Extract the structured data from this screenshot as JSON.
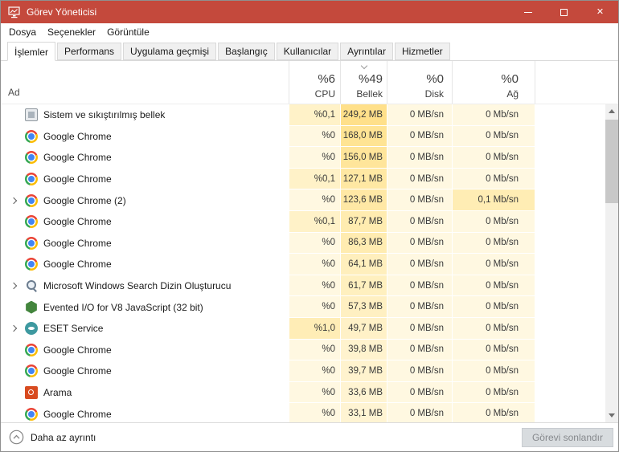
{
  "window": {
    "title": "Görev Yöneticisi"
  },
  "colors": {
    "titlebar": "#c4493c",
    "heat_base": "#fff8e1"
  },
  "menu": [
    "Dosya",
    "Seçenekler",
    "Görüntüle"
  ],
  "tabs": [
    "İşlemler",
    "Performans",
    "Uygulama geçmişi",
    "Başlangıç",
    "Kullanıcılar",
    "Ayrıntılar",
    "Hizmetler"
  ],
  "selected_tab": "İşlemler",
  "table": {
    "name_column_header": "Ad",
    "value_columns": [
      {
        "id": "cpu",
        "percent": "%6",
        "name": "CPU",
        "sorted": false
      },
      {
        "id": "mem",
        "percent": "%49",
        "name": "Bellek",
        "sorted": true
      },
      {
        "id": "disk",
        "percent": "%0",
        "name": "Disk",
        "sorted": false
      },
      {
        "id": "net",
        "percent": "%0",
        "name": "Ağ",
        "sorted": false
      }
    ],
    "rows": [
      {
        "name": "Sistem ve sıkıştırılmış bellek",
        "icon": "system",
        "expandable": false,
        "cpu": "%0,1",
        "mem": "249,2 MB",
        "disk": "0 MB/sn",
        "net": "0 Mb/sn",
        "heat": {
          "cpu": "#fff2c8",
          "mem": "#ffe08a",
          "disk": "#fff8e1",
          "net": "#fff8e1"
        }
      },
      {
        "name": "Google Chrome",
        "icon": "chrome",
        "expandable": false,
        "cpu": "%0",
        "mem": "168,0 MB",
        "disk": "0 MB/sn",
        "net": "0 Mb/sn",
        "heat": {
          "cpu": "#fff8e1",
          "mem": "#ffe494",
          "disk": "#fff8e1",
          "net": "#fff8e1"
        }
      },
      {
        "name": "Google Chrome",
        "icon": "chrome",
        "expandable": false,
        "cpu": "%0",
        "mem": "156,0 MB",
        "disk": "0 MB/sn",
        "net": "0 Mb/sn",
        "heat": {
          "cpu": "#fff8e1",
          "mem": "#ffe59a",
          "disk": "#fff8e1",
          "net": "#fff8e1"
        }
      },
      {
        "name": "Google Chrome",
        "icon": "chrome",
        "expandable": false,
        "cpu": "%0,1",
        "mem": "127,1 MB",
        "disk": "0 MB/sn",
        "net": "0 Mb/sn",
        "heat": {
          "cpu": "#fff2c8",
          "mem": "#ffe8a3",
          "disk": "#fff8e1",
          "net": "#fff8e1"
        }
      },
      {
        "name": "Google Chrome (2)",
        "icon": "chrome",
        "expandable": true,
        "cpu": "%0",
        "mem": "123,6 MB",
        "disk": "0 MB/sn",
        "net": "0,1 Mb/sn",
        "heat": {
          "cpu": "#fff8e1",
          "mem": "#ffe8a5",
          "disk": "#fff8e1",
          "net": "#ffedb4"
        }
      },
      {
        "name": "Google Chrome",
        "icon": "chrome",
        "expandable": false,
        "cpu": "%0,1",
        "mem": "87,7 MB",
        "disk": "0 MB/sn",
        "net": "0 Mb/sn",
        "heat": {
          "cpu": "#fff2c8",
          "mem": "#ffecb0",
          "disk": "#fff8e1",
          "net": "#fff8e1"
        }
      },
      {
        "name": "Google Chrome",
        "icon": "chrome",
        "expandable": false,
        "cpu": "%0",
        "mem": "86,3 MB",
        "disk": "0 MB/sn",
        "net": "0 Mb/sn",
        "heat": {
          "cpu": "#fff8e1",
          "mem": "#ffecb1",
          "disk": "#fff8e1",
          "net": "#fff8e1"
        }
      },
      {
        "name": "Google Chrome",
        "icon": "chrome",
        "expandable": false,
        "cpu": "%0",
        "mem": "64,1 MB",
        "disk": "0 MB/sn",
        "net": "0 Mb/sn",
        "heat": {
          "cpu": "#fff8e1",
          "mem": "#ffefbd",
          "disk": "#fff8e1",
          "net": "#fff8e1"
        }
      },
      {
        "name": "Microsoft Windows Search Dizin Oluşturucu",
        "icon": "search-indexer",
        "expandable": true,
        "cpu": "%0",
        "mem": "61,7 MB",
        "disk": "0 MB/sn",
        "net": "0 Mb/sn",
        "heat": {
          "cpu": "#fff8e1",
          "mem": "#fff0bf",
          "disk": "#fff8e1",
          "net": "#fff8e1"
        }
      },
      {
        "name": "Evented I/O for V8 JavaScript (32 bit)",
        "icon": "node",
        "expandable": false,
        "cpu": "%0",
        "mem": "57,3 MB",
        "disk": "0 MB/sn",
        "net": "0 Mb/sn",
        "heat": {
          "cpu": "#fff8e1",
          "mem": "#fff0c2",
          "disk": "#fff8e1",
          "net": "#fff8e1"
        }
      },
      {
        "name": "ESET Service",
        "icon": "eset",
        "expandable": true,
        "cpu": "%1,0",
        "mem": "49,7 MB",
        "disk": "0 MB/sn",
        "net": "0 Mb/sn",
        "heat": {
          "cpu": "#ffedb6",
          "mem": "#fff1c7",
          "disk": "#fff8e1",
          "net": "#fff8e1"
        }
      },
      {
        "name": "Google Chrome",
        "icon": "chrome",
        "expandable": false,
        "cpu": "%0",
        "mem": "39,8 MB",
        "disk": "0 MB/sn",
        "net": "0 Mb/sn",
        "heat": {
          "cpu": "#fff8e1",
          "mem": "#fff3ce",
          "disk": "#fff8e1",
          "net": "#fff8e1"
        }
      },
      {
        "name": "Google Chrome",
        "icon": "chrome",
        "expandable": false,
        "cpu": "%0",
        "mem": "39,7 MB",
        "disk": "0 MB/sn",
        "net": "0 Mb/sn",
        "heat": {
          "cpu": "#fff8e1",
          "mem": "#fff3ce",
          "disk": "#fff8e1",
          "net": "#fff8e1"
        }
      },
      {
        "name": "Arama",
        "icon": "arama",
        "expandable": false,
        "cpu": "%0",
        "mem": "33,6 MB",
        "disk": "0 MB/sn",
        "net": "0 Mb/sn",
        "heat": {
          "cpu": "#fff8e1",
          "mem": "#fff4d2",
          "disk": "#fff8e1",
          "net": "#fff8e1"
        }
      },
      {
        "name": "Google Chrome",
        "icon": "chrome",
        "expandable": false,
        "cpu": "%0",
        "mem": "33,1 MB",
        "disk": "0 MB/sn",
        "net": "0 Mb/sn",
        "heat": {
          "cpu": "#fff8e1",
          "mem": "#fff4d3",
          "disk": "#fff8e1",
          "net": "#fff8e1"
        }
      }
    ]
  },
  "footer": {
    "toggle_label": "Daha az ayrıntı",
    "end_task_label": "Görevi sonlandır"
  }
}
